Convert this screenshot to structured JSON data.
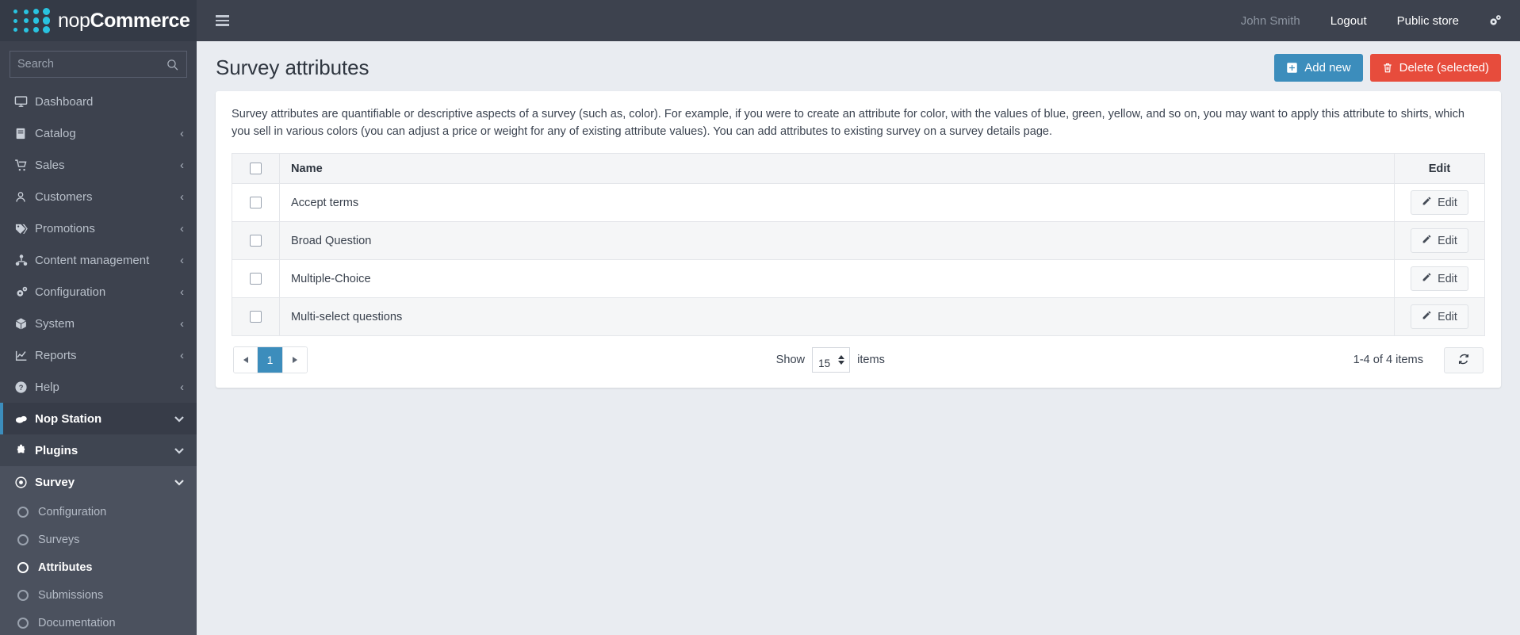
{
  "brand": {
    "name_light": "nop",
    "name_bold": "Commerce",
    "logo_icon": "nopcommerce-dots-logo"
  },
  "search": {
    "placeholder": "Search",
    "value": "",
    "icon": "search-icon"
  },
  "sidebar": {
    "items": [
      {
        "label": "Dashboard",
        "icon": "monitor-icon",
        "caret": ""
      },
      {
        "label": "Catalog",
        "icon": "book-icon",
        "caret": "‹"
      },
      {
        "label": "Sales",
        "icon": "cart-icon",
        "caret": "‹"
      },
      {
        "label": "Customers",
        "icon": "user-icon",
        "caret": "‹"
      },
      {
        "label": "Promotions",
        "icon": "tags-icon",
        "caret": "‹"
      },
      {
        "label": "Content management",
        "icon": "sitemap-icon",
        "caret": "‹"
      },
      {
        "label": "Configuration",
        "icon": "gears-icon",
        "caret": "‹"
      },
      {
        "label": "System",
        "icon": "cube-icon",
        "caret": "‹"
      },
      {
        "label": "Reports",
        "icon": "chart-line-icon",
        "caret": "‹"
      },
      {
        "label": "Help",
        "icon": "question-circle-icon",
        "caret": "‹"
      }
    ],
    "nop_station": {
      "label": "Nop Station",
      "icon": "cloud-icon",
      "caret": "⌄"
    },
    "plugins": {
      "label": "Plugins",
      "icon": "puzzle-piece-icon",
      "caret": "⌄"
    },
    "survey": {
      "label": "Survey",
      "icon": "dot-circle-icon",
      "caret": "⌄"
    },
    "survey_children": [
      {
        "label": "Configuration",
        "icon": "circle-icon",
        "active": false
      },
      {
        "label": "Surveys",
        "icon": "circle-icon",
        "active": false
      },
      {
        "label": "Attributes",
        "icon": "circle-icon",
        "active": true
      },
      {
        "label": "Submissions",
        "icon": "circle-icon",
        "active": false
      },
      {
        "label": "Documentation",
        "icon": "circle-icon",
        "active": false
      }
    ]
  },
  "topbar": {
    "menu_toggle_icon": "hamburger-icon",
    "user_name": "John Smith",
    "logout": "Logout",
    "public_store": "Public store",
    "settings_icon": "gears-icon"
  },
  "page": {
    "title": "Survey attributes",
    "add_new": "Add new",
    "add_new_icon": "plus-square-icon",
    "delete_selected": "Delete (selected)",
    "delete_icon": "trash-icon",
    "description": "Survey attributes are quantifiable or descriptive aspects of a survey (such as, color). For example, if you were to create an attribute for color, with the values of blue, green, yellow, and so on, you may want to apply this attribute to shirts, which you sell in various colors (you can adjust a price or weight for any of existing attribute values). You can add attributes to existing survey on a survey details page."
  },
  "table": {
    "columns": {
      "name": "Name",
      "edit": "Edit"
    },
    "rows": [
      {
        "name": "Accept terms",
        "edit_label": "Edit",
        "checked": false
      },
      {
        "name": "Broad Question",
        "edit_label": "Edit",
        "checked": false
      },
      {
        "name": "Multiple-Choice",
        "edit_label": "Edit",
        "checked": false
      },
      {
        "name": "Multi-select questions",
        "edit_label": "Edit",
        "checked": false
      }
    ]
  },
  "footer": {
    "page_current": "1",
    "prev_icon": "triangle-left-icon",
    "next_icon": "triangle-right-icon",
    "show_label": "Show",
    "page_size": "15",
    "items_label": "items",
    "count_text": "1-4 of 4 items",
    "refresh_icon": "refresh-icon"
  },
  "colors": {
    "accent": "#3c8dbc",
    "danger": "#e74c3c",
    "sidebar": "#3d424e",
    "logo": "#29c3e0",
    "content_bg": "#e9ecf1"
  }
}
